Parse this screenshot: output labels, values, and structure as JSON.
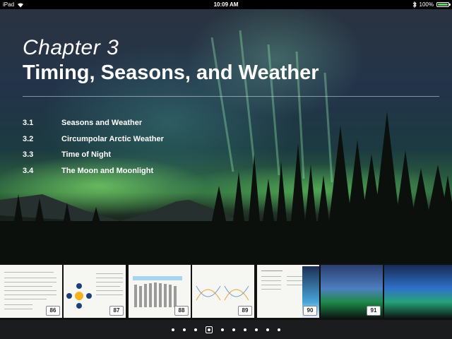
{
  "status_bar": {
    "device": "iPad",
    "time": "10:09 AM",
    "battery": "100%",
    "battery_level": 1.0,
    "battery_color": "#5fd35f"
  },
  "chapter": {
    "label": "Chapter 3",
    "title": "Timing, Seasons, and Weather"
  },
  "toc": [
    {
      "num": "3.1",
      "title": "Seasons and Weather"
    },
    {
      "num": "3.2",
      "title": "Circumpolar Arctic Weather"
    },
    {
      "num": "3.3",
      "title": "Time of Night"
    },
    {
      "num": "3.4",
      "title": "The Moon and Moonlight"
    }
  ],
  "thumbnails": {
    "page_numbers": [
      "86",
      "87",
      "88",
      "89",
      "90",
      "91"
    ]
  },
  "pager": {
    "dot_count": 10,
    "active_index": 3
  },
  "colors": {
    "aurora": "#7ef06a",
    "strip_background": "#111111",
    "pager_background": "#1b1c1e"
  }
}
